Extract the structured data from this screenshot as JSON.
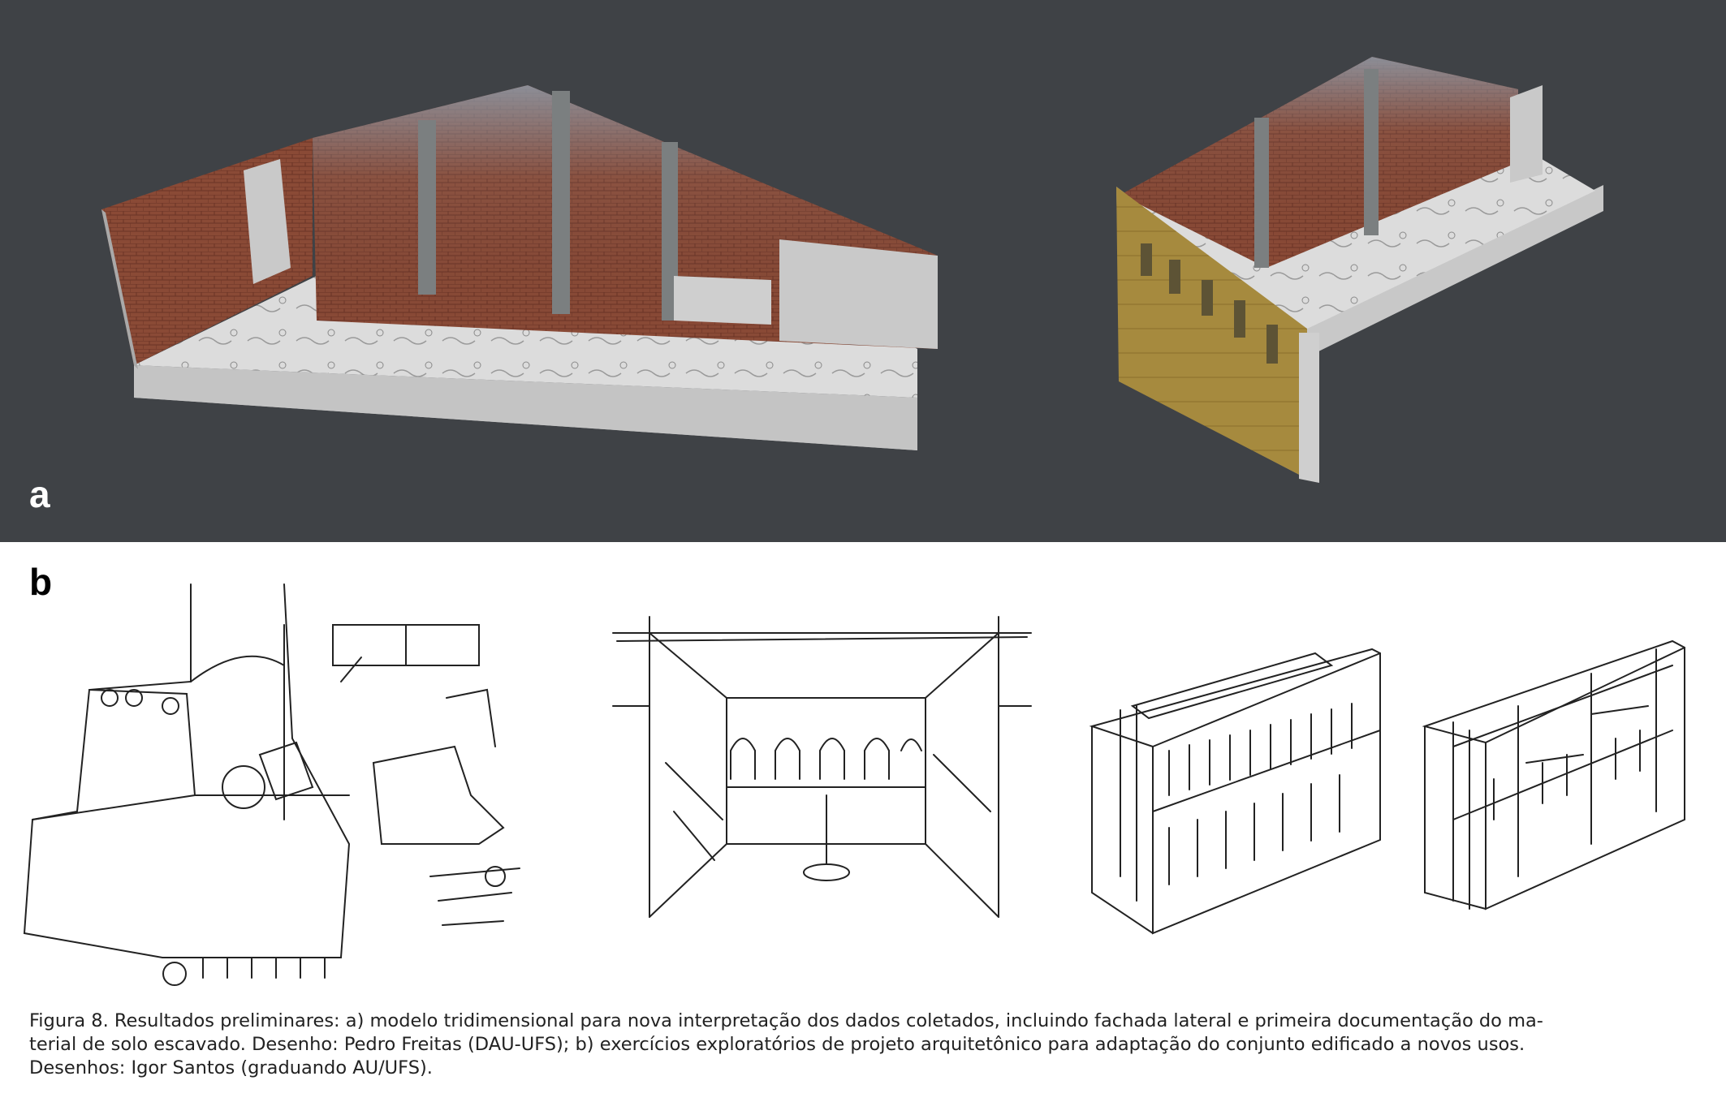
{
  "panels": {
    "a": {
      "letter": "a"
    },
    "b": {
      "letter": "b"
    }
  },
  "caption": {
    "lines": [
      "Figura 8. Resultados preliminares: a) modelo tridimensional para nova interpretação dos dados coletados, incluindo fachada lateral e primeira documentação do ma-",
      "terial de solo escavado. Desenho: Pedro Freitas (DAU-UFS); b) exercícios exploratórios de projeto arquitetônico para adaptação do conjunto edificado a novos usos.",
      "Desenhos: Igor Santos (graduando AU/UFS)."
    ]
  },
  "colors": {
    "panel_a_background": "#3f4246",
    "brick": "#8a4a36",
    "plaster": "#d7d7d7",
    "model_base": "#c9c9c9",
    "facade_yellow": "#a88a3a",
    "sketch_ink": "#222222"
  }
}
